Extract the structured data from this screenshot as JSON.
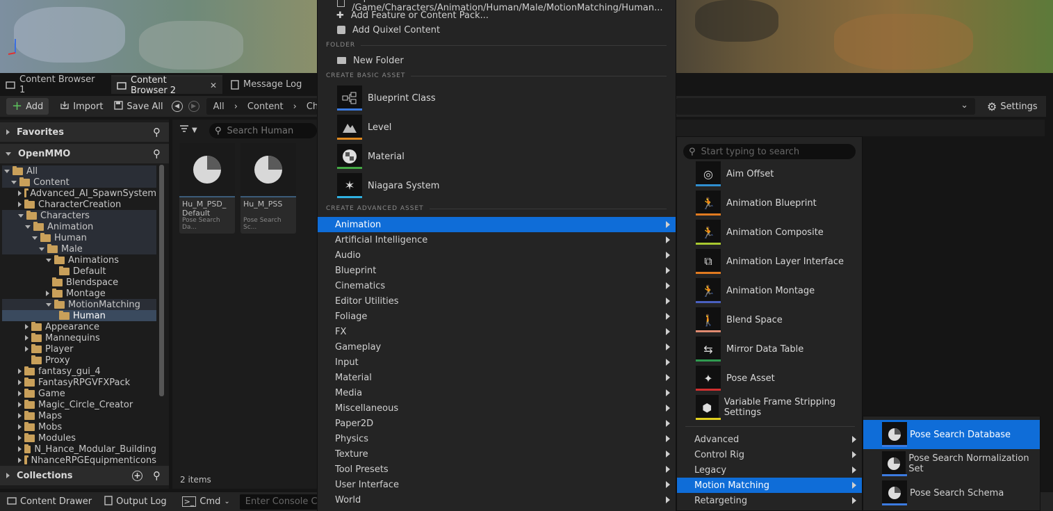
{
  "tabs": [
    {
      "label": "Content Browser 1"
    },
    {
      "label": "Content Browser 2"
    },
    {
      "label": "Message Log"
    }
  ],
  "toolbar": {
    "add": "Add",
    "import": "Import",
    "save_all": "Save All",
    "breadcrumb": [
      "All",
      "Content",
      "Char"
    ],
    "settings": "Settings"
  },
  "left": {
    "favorites": "Favorites",
    "project": "OpenMMO",
    "collections": "Collections",
    "tree": [
      {
        "label": "All",
        "depth": 0,
        "state": "open",
        "hl": true
      },
      {
        "label": "Content",
        "depth": 1,
        "state": "open",
        "hl": true
      },
      {
        "label": "Advanced_AI_SpawnSystem",
        "depth": 2,
        "state": "closed"
      },
      {
        "label": "CharacterCreation",
        "depth": 2,
        "state": "closed"
      },
      {
        "label": "Characters",
        "depth": 2,
        "state": "open",
        "hl": true
      },
      {
        "label": "Animation",
        "depth": 3,
        "state": "open",
        "hl": true
      },
      {
        "label": "Human",
        "depth": 4,
        "state": "open",
        "hl": true
      },
      {
        "label": "Male",
        "depth": 5,
        "state": "open",
        "hl": true
      },
      {
        "label": "Animations",
        "depth": 6,
        "state": "open"
      },
      {
        "label": "Default",
        "depth": 7,
        "state": "none"
      },
      {
        "label": "Blendspace",
        "depth": 6,
        "state": "none"
      },
      {
        "label": "Montage",
        "depth": 6,
        "state": "closed"
      },
      {
        "label": "MotionMatching",
        "depth": 6,
        "state": "open",
        "hl": true
      },
      {
        "label": "Human",
        "depth": 7,
        "state": "none",
        "sel": true
      },
      {
        "label": "Appearance",
        "depth": 3,
        "state": "closed"
      },
      {
        "label": "Mannequins",
        "depth": 3,
        "state": "closed"
      },
      {
        "label": "Player",
        "depth": 3,
        "state": "closed"
      },
      {
        "label": "Proxy",
        "depth": 3,
        "state": "none"
      },
      {
        "label": "fantasy_gui_4",
        "depth": 2,
        "state": "closed"
      },
      {
        "label": "FantasyRPGVFXPack",
        "depth": 2,
        "state": "closed"
      },
      {
        "label": "Game",
        "depth": 2,
        "state": "closed"
      },
      {
        "label": "Magic_Circle_Creator",
        "depth": 2,
        "state": "closed"
      },
      {
        "label": "Maps",
        "depth": 2,
        "state": "closed"
      },
      {
        "label": "Mobs",
        "depth": 2,
        "state": "closed"
      },
      {
        "label": "Modules",
        "depth": 2,
        "state": "closed"
      },
      {
        "label": "N_Hance_Modular_Building",
        "depth": 2,
        "state": "closed"
      },
      {
        "label": "NhanceRPGEquipmenticons",
        "depth": 2,
        "state": "closed"
      }
    ]
  },
  "content": {
    "search_placeholder": "Search Human",
    "assets": [
      {
        "name": "Hu_M_PSD_ Default",
        "type": "Pose Search Da..."
      },
      {
        "name": "Hu_M_PSS",
        "type": "Pose Search Sc..."
      }
    ],
    "count": "2 items"
  },
  "menu": {
    "top_items": [
      "Import to /Game/Characters/Animation/Human/Male/MotionMatching/Human...",
      "Add Feature or Content Pack...",
      "Add Quixel Content"
    ],
    "folder_header": "FOLDER",
    "new_folder": "New Folder",
    "basic_header": "CREATE BASIC ASSET",
    "basic_assets": [
      {
        "label": "Blueprint Class",
        "color": "#3c7be0"
      },
      {
        "label": "Level",
        "color": "#e08a20"
      },
      {
        "label": "Material",
        "color": "#45a845"
      },
      {
        "label": "Niagara System",
        "color": "#2fb0e0"
      }
    ],
    "advanced_header": "CREATE ADVANCED ASSET",
    "categories": [
      "Animation",
      "Artificial Intelligence",
      "Audio",
      "Blueprint",
      "Cinematics",
      "Editor Utilities",
      "Foliage",
      "FX",
      "Gameplay",
      "Input",
      "Material",
      "Media",
      "Miscellaneous",
      "Paper2D",
      "Physics",
      "Texture",
      "Tool Presets",
      "User Interface",
      "World"
    ]
  },
  "submenu": {
    "search_placeholder": "Start typing to search",
    "items": [
      {
        "label": "Aim Offset",
        "color": "#2f8fd0"
      },
      {
        "label": "Animation Blueprint",
        "color": "#e07a20"
      },
      {
        "label": "Animation Composite",
        "color": "#a8c830"
      },
      {
        "label": "Animation Layer Interface",
        "color": "#e07a20"
      },
      {
        "label": "Animation Montage",
        "color": "#4a60c0"
      },
      {
        "label": "Blend Space",
        "color": "#e08a70"
      },
      {
        "label": "Mirror Data Table",
        "color": "#2f9a50"
      },
      {
        "label": "Pose Asset",
        "color": "#d03030"
      },
      {
        "label": "Variable Frame Stripping Settings",
        "color": "#e0d020"
      }
    ],
    "groups": [
      "Advanced",
      "Control Rig",
      "Legacy",
      "Motion Matching",
      "Retargeting"
    ]
  },
  "motion_matching": {
    "items": [
      "Pose Search Database",
      "Pose Search Normalization Set",
      "Pose Search Schema"
    ]
  },
  "bottom": {
    "content_drawer": "Content Drawer",
    "output_log": "Output Log",
    "cmd": "Cmd",
    "console_placeholder": "Enter Console Command"
  }
}
